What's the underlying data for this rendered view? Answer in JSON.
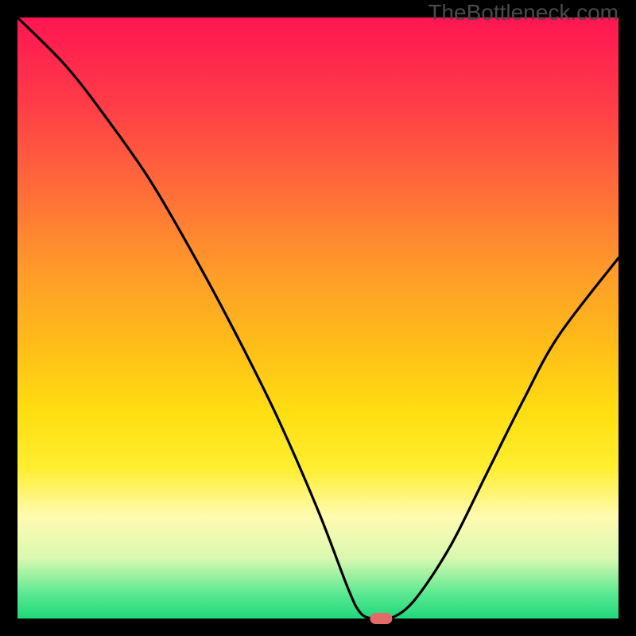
{
  "watermark": "TheBottleneck.com",
  "chart_data": {
    "type": "line",
    "title": "",
    "xlabel": "",
    "ylabel": "",
    "xlim": [
      0,
      100
    ],
    "ylim": [
      0,
      100
    ],
    "legend": false,
    "grid": false,
    "background_gradient": {
      "top": "#ff1552",
      "bottom": "#20d77a"
    },
    "series": [
      {
        "name": "bottleneck-curve",
        "x": [
          0,
          8,
          15,
          22,
          29,
          36,
          43,
          50,
          55,
          57,
          59,
          62,
          66,
          72,
          78,
          84,
          90,
          100
        ],
        "y": [
          100,
          92,
          83,
          73,
          61,
          48,
          34,
          18,
          5,
          1,
          0,
          0,
          3,
          12,
          24,
          36,
          47,
          60
        ],
        "color": "#000000"
      }
    ],
    "marker": {
      "x": 60.5,
      "y": 0,
      "color": "#e46a6a",
      "shape": "pill"
    }
  }
}
